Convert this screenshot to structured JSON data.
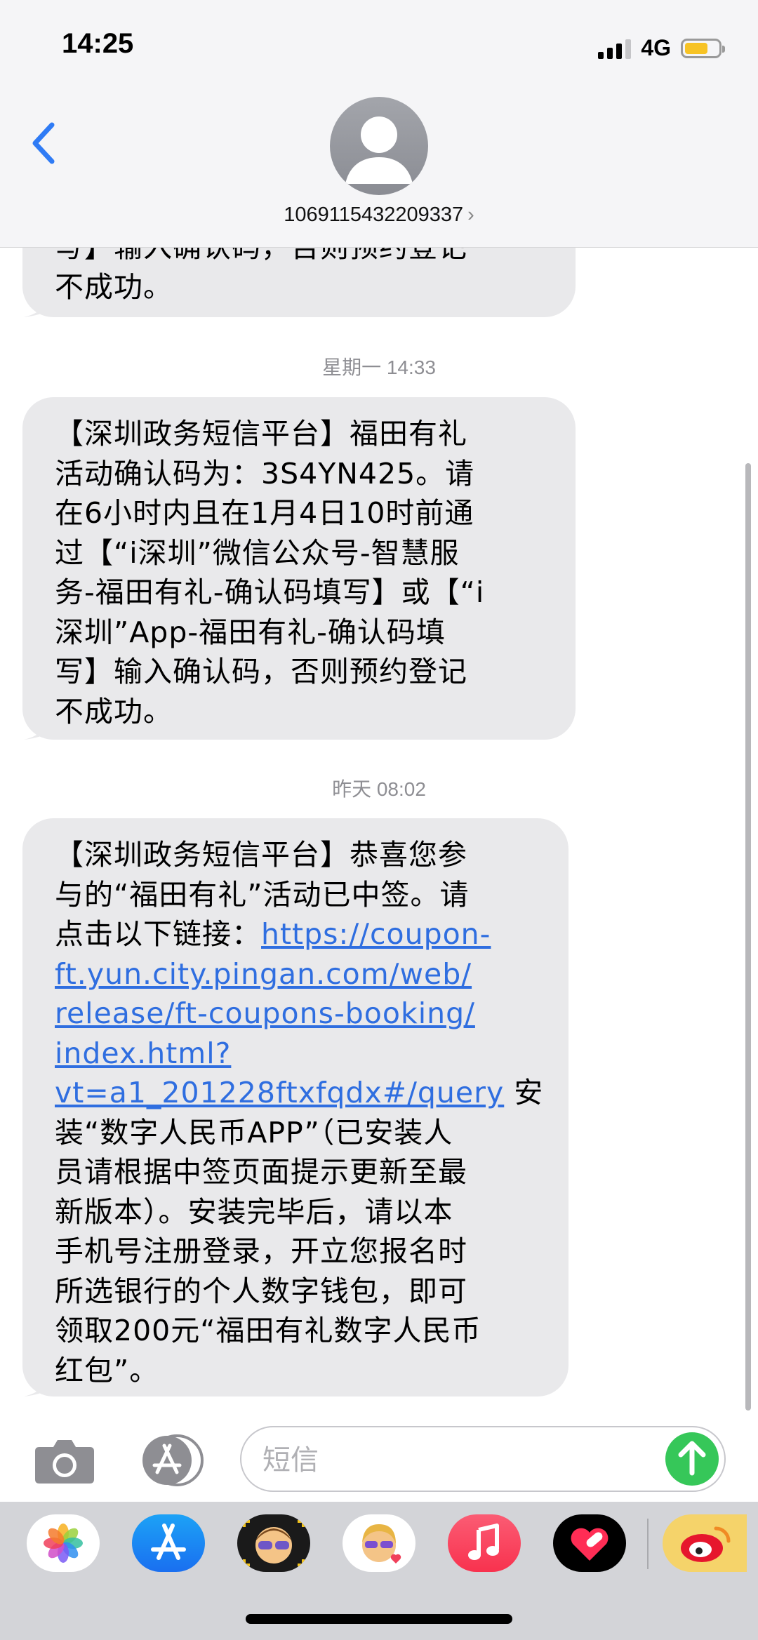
{
  "status_bar": {
    "time": "14:25",
    "network": "4G",
    "signal_bars": 3,
    "battery_level": 0.7,
    "battery_color": "#f7c325"
  },
  "header": {
    "contact_number": "1069115432209337",
    "contact_chevron": "›",
    "back_icon": "chevron-left-icon",
    "avatar_icon": "person-silhouette-icon"
  },
  "messages": [
    {
      "lines": [
        "写】输入确认码，否则预约登记",
        "不成功。"
      ]
    },
    {
      "timestamp": "星期一 14:33",
      "lines": [
        "【深圳政务短信平台】福田有礼",
        "活动确认码为：3S4YN425。请",
        "在6小时内且在1月4日10时前通",
        "过【“i深圳”微信公众号-智慧服",
        "务-福田有礼-确认码填写】或【“i",
        "深圳”App-福田有礼-确认码填",
        "写】输入确认码，否则预约登记",
        "不成功。"
      ]
    },
    {
      "timestamp": "昨天 08:02",
      "line1": "【深圳政务短信平台】恭喜您参",
      "line2": "与的“福田有礼”活动已中签。请",
      "line3_prefix": "点击以下链接：",
      "link_lines": [
        "https://coupon-",
        "ft.yun.city.pingan.com/web/",
        "release/ft-coupons-booking/",
        "index.html?",
        "vt=a1_201228ftxfqdx#/query"
      ],
      "link_suffix": " 安",
      "rest_lines": [
        "装“数字人民币APP”（已安装人",
        "员请根据中签页面提示更新至最",
        "新版本）。安装完毕后，请以本",
        "手机号注册登录，开立您报名时",
        "所选银行的个人数字钱包，即可",
        "领取200元“福田有礼数字人民币",
        "红包”。"
      ]
    }
  ],
  "input_bar": {
    "placeholder": "短信",
    "camera_icon": "camera-icon",
    "apps_icon": "app-store-icon",
    "send_icon": "arrow-up-icon",
    "send_color": "#36c759"
  },
  "app_drawer": {
    "apps": [
      "photos-icon",
      "app-store-icon",
      "memoji-camera-icon",
      "memoji-stickers-icon",
      "music-icon",
      "digital-touch-icon",
      "weibo-icon"
    ]
  },
  "colors": {
    "bubble": "#e9e9eb",
    "link": "#2f6ee0",
    "accent_blue": "#2f7bf5"
  }
}
